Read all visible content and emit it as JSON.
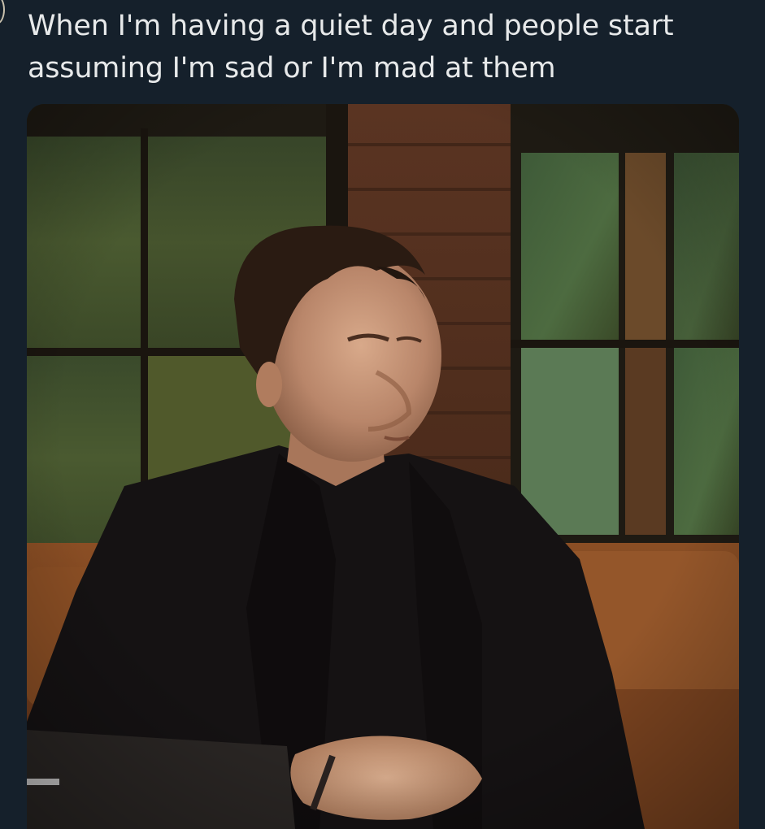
{
  "post": {
    "text": "When I'm having a quiet day and people start\nassuming I'm sad or I'm mad at them"
  },
  "media": {
    "type": "photo"
  },
  "icons": {
    "avatar": "avatar-icon"
  },
  "colors": {
    "background": "#15202b",
    "text": "#e7e9ea"
  }
}
